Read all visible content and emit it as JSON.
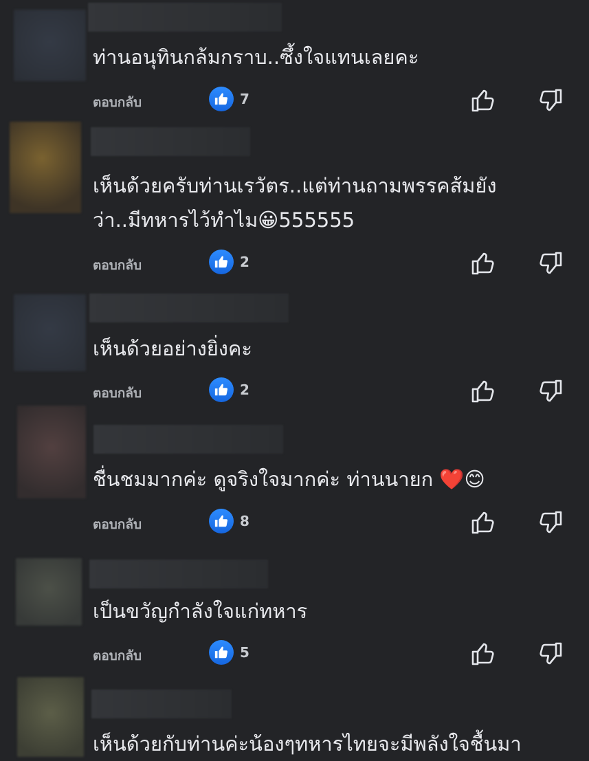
{
  "comments": [
    {
      "text": "ท่านอนุทินกล้มกราบ..ซึ้งใจแทนเลยคะ",
      "reply_label": "ตอบกลับ",
      "likes": "7",
      "avatar_color": "#2f3540"
    },
    {
      "text": "เห็นด้วยครับท่านเรวัตร..แต่ท่านถามพรรคส้มยัง\nว่า..มีทหารไว้ทำไม😀555555",
      "reply_label": "ตอบกลับ",
      "likes": "2",
      "avatar_color": "#5a4a2a"
    },
    {
      "text": "เห็นด้วยอย่างยิ่งคะ",
      "reply_label": "ตอบกลับ",
      "likes": "2",
      "avatar_color": "#2f3540"
    },
    {
      "text": "ชื่นชมมากค่ะ ดูจริงใจมากค่ะ ท่านนายก ❤️😊",
      "reply_label": "ตอบกลับ",
      "likes": "8",
      "avatar_color": "#3e3434"
    },
    {
      "text": "เป็นขวัญกำลังใจแก่ทหาร",
      "reply_label": "ตอบกลับ",
      "likes": "5",
      "avatar_color": "#3f4340"
    },
    {
      "text": "เห็นด้วยกับท่านค่ะน้องๆทหารไทยจะมีพลังใจชื้นมา",
      "reply_label": "",
      "likes": "",
      "avatar_color": "#4a4d3c"
    }
  ]
}
